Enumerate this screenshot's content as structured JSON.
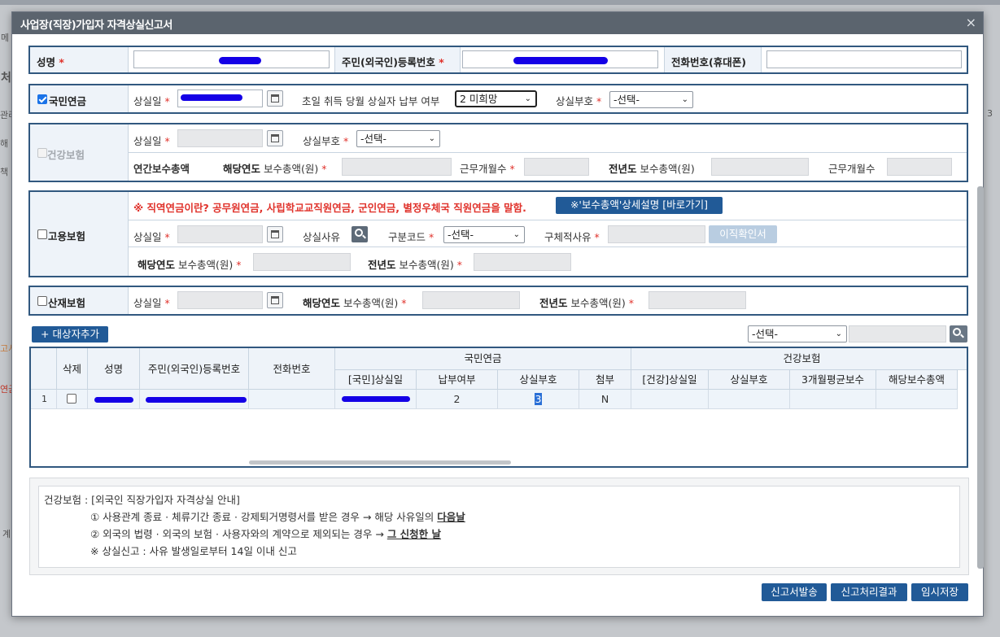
{
  "background": {
    "frags": [
      "메",
      "처",
      "관리",
      "해",
      "책",
      "고서",
      "연금",
      "계",
      "3"
    ]
  },
  "dialog": {
    "title": "사업장(직장)가입자 자격상실신고서",
    "close": "×"
  },
  "person": {
    "name_label": "성명",
    "rrn_label": "주민(외국인)등록번호",
    "phone_label": "전화번호(휴대폰)"
  },
  "pension": {
    "label": "국민연금",
    "checked": true,
    "loss_date_label": "상실일",
    "first_day_label": "초일 취득 당월 상실자 납부 여부",
    "first_day_value": "2 미희망",
    "loss_code_label": "상실부호",
    "loss_code_value": "-선택-"
  },
  "health": {
    "label": "건강보험",
    "loss_date_label": "상실일",
    "loss_code_label": "상실부호",
    "loss_code_value": "-선택-",
    "annual_total_label": "연간보수총액",
    "cur_year_label": "해당연도",
    "amount_label": "보수총액(원)",
    "months_label": "근무개월수",
    "prev_year_label": "전년도"
  },
  "employment": {
    "label": "고용보험",
    "notice": "※ 직역연금이란? 공무원연금, 사립학교교직원연금, 군인연금, 별정우체국 직원연금을 말함.",
    "link_button": "※'보수총액'상세설명 [바로가기]",
    "loss_date_label": "상실일",
    "reason_label": "상실사유",
    "code_label": "구분코드",
    "code_value": "-선택-",
    "detail_reason_label": "구체적사유",
    "confirm_button": "이직확인서",
    "cur_year_label": "해당연도",
    "amount_label": "보수총액(원)",
    "prev_year_label": "전년도"
  },
  "industrial": {
    "label": "산재보험",
    "loss_date_label": "상실일",
    "cur_year_label": "해당연도",
    "amount_label": "보수총액(원)",
    "prev_year_label": "전년도"
  },
  "toolbar": {
    "add_button": "+ 대상자추가",
    "filter_value": "-선택-"
  },
  "grid": {
    "h_delete": "삭제",
    "h_name": "성명",
    "h_rrn": "주민(외국인)등록번호",
    "h_phone": "전화번호",
    "h_group_pension": "국민연금",
    "h_group_health": "건강보험",
    "h_pension_loss": "[국민]상실일",
    "h_payment": "납부여부",
    "h_pension_code": "상실부호",
    "h_attach": "첨부",
    "h_health_loss": "[건강]상실일",
    "h_health_code": "상실부호",
    "h_avg_pay": "3개월평균보수",
    "h_cur_pay": "해당보수총액",
    "row": {
      "no": "1",
      "payment": "2",
      "pension_code": "3",
      "attach": "N"
    }
  },
  "info": {
    "line1": "건강보험 : [외국인 직장가입자 자격상실 안내]",
    "line2a": "① 사용관계 종료 · 체류기간 종료 · 강제퇴거명령서를 받은 경우 → 해당 사유일의 ",
    "line2b": "다음날",
    "line3a": "② 외국의 법령 · 외국의 보험 · 사용자와의 계약으로 제외되는 경우 → ",
    "line3b": "그 신청한 날",
    "line4": "※ 상실신고 : 사유 발생일로부터 14일 이내 신고"
  },
  "footer": {
    "submit": "신고서발송",
    "result": "신고처리결과",
    "save": "임시저장"
  }
}
